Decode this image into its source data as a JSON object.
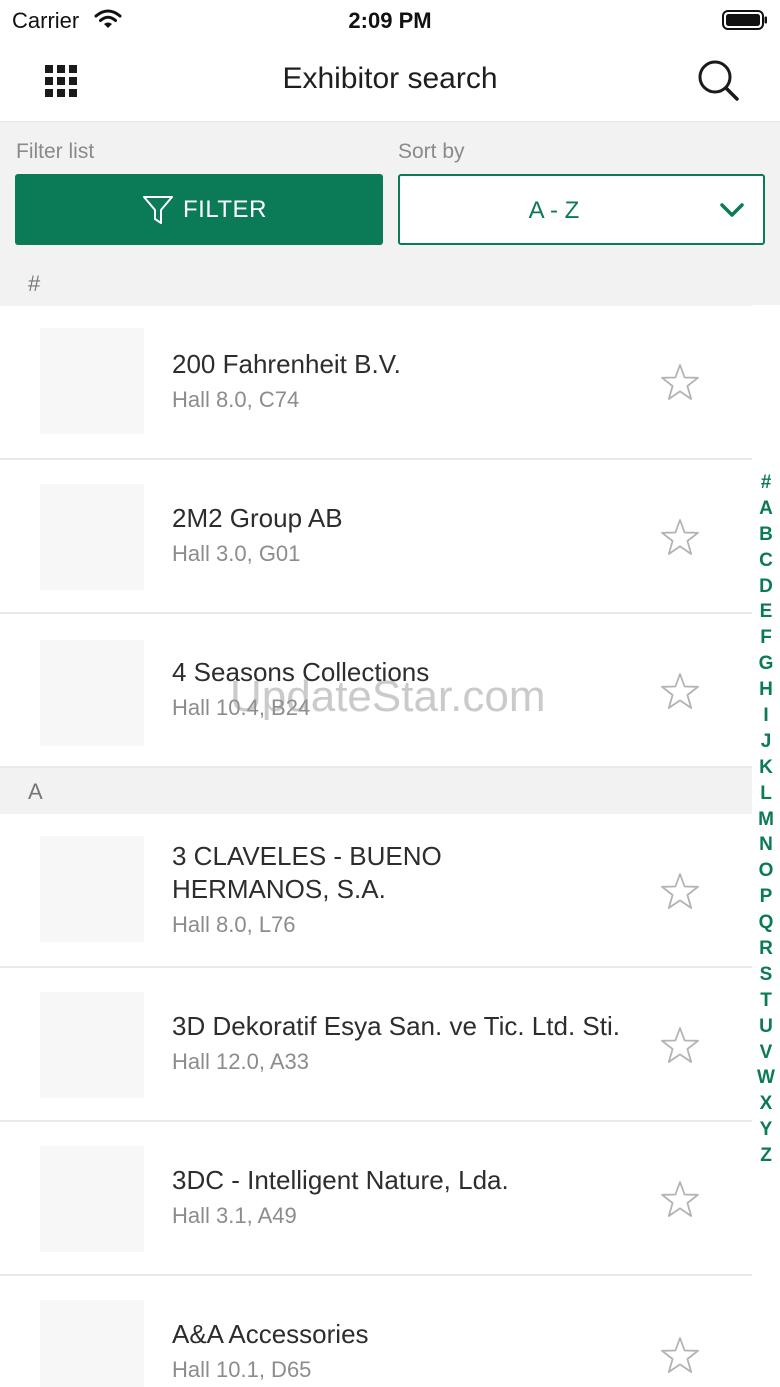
{
  "status_bar": {
    "carrier": "Carrier",
    "time": "2:09 PM"
  },
  "header": {
    "title": "Exhibitor search"
  },
  "controls": {
    "filter_label": "Filter list",
    "filter_button": "FILTER",
    "sort_label": "Sort by",
    "sort_value": "A - Z"
  },
  "sections": [
    {
      "header": "#"
    },
    {
      "header": "A"
    }
  ],
  "exhibitors": [
    {
      "name": "200 Fahrenheit B.V.",
      "location": "Hall 8.0, C74"
    },
    {
      "name": "2M2 Group AB",
      "location": "Hall 3.0, G01"
    },
    {
      "name": "4 Seasons Collections",
      "location": "Hall 10.4, B24"
    },
    {
      "name": "3 CLAVELES - BUENO HERMANOS, S.A.",
      "location": "Hall 8.0, L76"
    },
    {
      "name": "3D Dekoratif Esya San. ve Tic. Ltd. Sti.",
      "location": "Hall 12.0, A33"
    },
    {
      "name": "3DC - Intelligent Nature, Lda.",
      "location": "Hall 3.1, A49"
    },
    {
      "name": "A&A Accessories",
      "location": "Hall 10.1, D65"
    }
  ],
  "index_letters": [
    "#",
    "A",
    "B",
    "C",
    "D",
    "E",
    "F",
    "G",
    "H",
    "I",
    "J",
    "K",
    "L",
    "M",
    "N",
    "O",
    "P",
    "Q",
    "R",
    "S",
    "T",
    "U",
    "V",
    "W",
    "X",
    "Y",
    "Z"
  ],
  "watermark": "UpdateStar.com",
  "colors": {
    "accent": "#0b7a57",
    "section_bg": "#f2f2f2"
  },
  "icons": {
    "nav_left": "grid-icon",
    "nav_right": "search-icon",
    "filter": "funnel-icon",
    "sort": "chevron-down-icon",
    "favorite": "star-outline-icon"
  }
}
